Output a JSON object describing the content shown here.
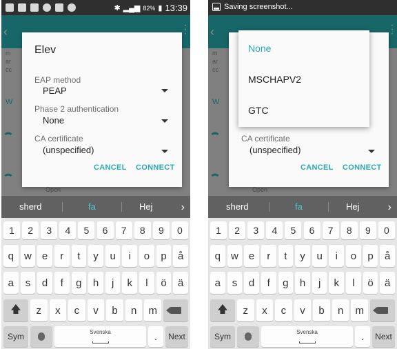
{
  "left": {
    "status": {
      "battery": "82%",
      "time": "13:39"
    },
    "background_fragments": [
      "m",
      "ar",
      "cc",
      "W",
      "Open"
    ],
    "dialog": {
      "title": "Elev",
      "eap_label": "EAP method",
      "eap_value": "PEAP",
      "phase2_label": "Phase 2 authentication",
      "phase2_value": "None",
      "ca_label": "CA certificate",
      "ca_value": "(unspecified)",
      "cancel": "CANCEL",
      "connect": "CONNECT"
    }
  },
  "right": {
    "status": {
      "notification": "Saving screenshot..."
    },
    "background_fragments": [
      "m",
      "ar",
      "cc",
      "W",
      "Open"
    ],
    "dialog": {
      "ca_label": "CA certificate",
      "ca_value": "(unspecified)",
      "cancel": "CANCEL",
      "connect": "CONNECT"
    },
    "popup": {
      "options": [
        "None",
        "MSCHAPV2",
        "GTC"
      ],
      "selected": "None"
    }
  },
  "keyboard": {
    "suggestions": [
      "sherd",
      "fa",
      "Hej"
    ],
    "numbers": [
      "1",
      "2",
      "3",
      "4",
      "5",
      "6",
      "7",
      "8",
      "9",
      "0"
    ],
    "row1": [
      "q",
      "w",
      "e",
      "r",
      "t",
      "y",
      "u",
      "i",
      "o",
      "p",
      "å"
    ],
    "row2": [
      "a",
      "s",
      "d",
      "f",
      "g",
      "h",
      "j",
      "k",
      "l",
      "ö",
      "ä"
    ],
    "row3": [
      "z",
      "x",
      "c",
      "v",
      "b",
      "n",
      "m"
    ],
    "sym": "Sym",
    "space_label": "Svenska",
    "period": ".",
    "next": "Next"
  },
  "colors": {
    "accent": "#2aa9b3",
    "appbar": "#2bbcc0",
    "suggestion_bar": "#616161"
  }
}
